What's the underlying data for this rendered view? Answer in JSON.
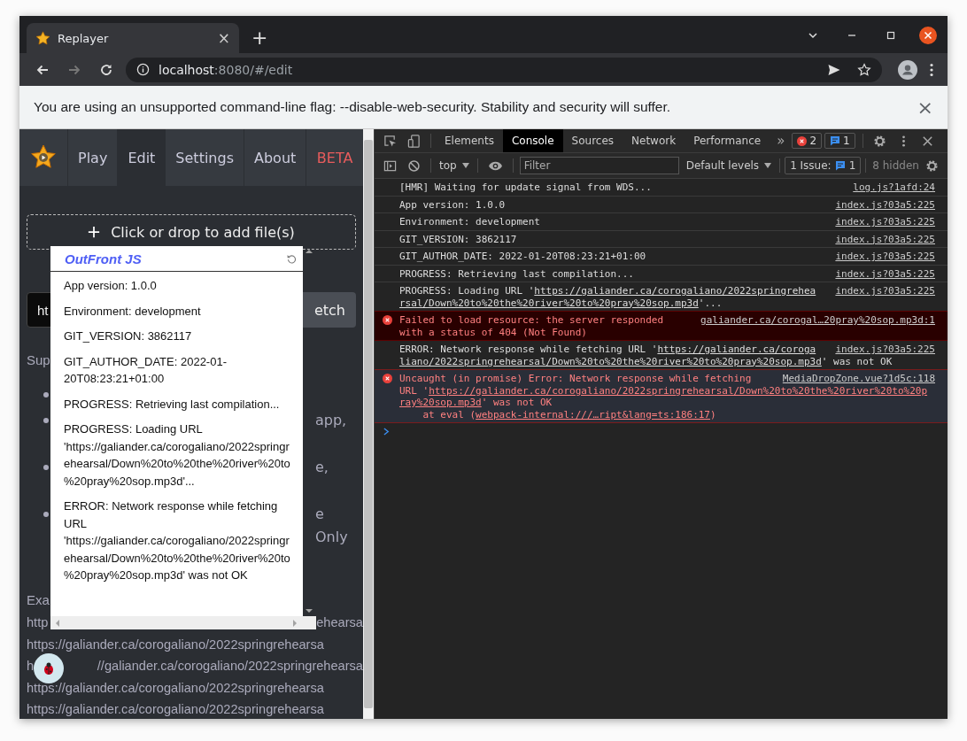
{
  "browser": {
    "tab": {
      "title": "Replayer",
      "close": "×"
    },
    "new_tab": "+",
    "forward_disabled": true,
    "address": {
      "host": "localhost",
      "path": ":8080/#/edit"
    }
  },
  "infobar": {
    "message": "You are using an unsupported command-line flag: --disable-web-security. Stability and security will suffer.",
    "close": "×"
  },
  "app": {
    "nav": [
      {
        "label": "Play",
        "selected": false,
        "kind": "normal"
      },
      {
        "label": "Edit",
        "selected": true,
        "kind": "normal"
      },
      {
        "label": "Settings",
        "selected": false,
        "kind": "normal"
      },
      {
        "label": "About",
        "selected": false,
        "kind": "normal"
      },
      {
        "label": "BETA",
        "selected": false,
        "kind": "beta"
      }
    ],
    "dropzone": "Click or drop to add file(s)",
    "url_field": {
      "value": "ht"
    },
    "fetch_button": "etch",
    "support_heading": "Sup",
    "bullets": [
      {
        "kind": "covered"
      },
      {
        "kind": "text",
        "lines": [
          "app,"
        ]
      },
      {
        "kind": "text",
        "lines": [
          "e,"
        ]
      },
      {
        "kind": "text",
        "lines": [
          "e",
          "Only"
        ]
      }
    ],
    "examples_heading": "Exa",
    "example_lines": [
      [
        "http",
        "ehearsa"
      ],
      [
        "https://galiander.ca/corogaliano/2022springrehearsa"
      ],
      [
        "h",
        "//galiander.ca/corogaliano/2022springrehearsa"
      ],
      [
        "https://galiander.ca/corogaliano/2022springrehearsa"
      ],
      [
        "https://galiander.ca/corogaliano/2022springrehearsa"
      ]
    ]
  },
  "log_popup": {
    "title": "OutFront JS",
    "entries": [
      "App version: 1.0.0",
      "Environment: development",
      "GIT_VERSION: 3862117",
      "GIT_AUTHOR_DATE: 2022-01-20T08:23:21+01:00",
      "PROGRESS: Retrieving last compilation...",
      "PROGRESS: Loading URL 'https://galiander.ca/corogaliano/2022springrehearsal/Down%20to%20the%20river%20to%20pray%20sop.mp3d'...",
      "ERROR: Network response while fetching URL 'https://galiander.ca/corogaliano/2022springrehearsal/Down%20to%20the%20river%20to%20pray%20sop.mp3d' was not OK"
    ]
  },
  "devtools": {
    "tabs": [
      {
        "label": "Elements",
        "selected": false
      },
      {
        "label": "Console",
        "selected": true
      },
      {
        "label": "Sources",
        "selected": false
      },
      {
        "label": "Network",
        "selected": false
      },
      {
        "label": "Performance",
        "selected": false
      }
    ],
    "more_tabs": "»",
    "error_count": "2",
    "message_count": "1",
    "context": "top",
    "filter": {
      "placeholder": "Filter"
    },
    "levels": "Default levels",
    "issues": "1 Issue:",
    "issues_count": "1",
    "hidden": "8 hidden",
    "messages": [
      {
        "kind": "log",
        "selected": false,
        "text": "[HMR] Waiting for update signal from WDS...",
        "source": "log.js?1afd:24"
      },
      {
        "kind": "log",
        "selected": false,
        "text": "App version: 1.0.0",
        "source": "index.js?03a5:225"
      },
      {
        "kind": "log",
        "selected": false,
        "text": "Environment: development",
        "source": "index.js?03a5:225"
      },
      {
        "kind": "log",
        "selected": false,
        "text": "GIT_VERSION: 3862117",
        "source": "index.js?03a5:225"
      },
      {
        "kind": "log",
        "selected": false,
        "text": "GIT_AUTHOR_DATE: 2022-01-20T08:23:21+01:00",
        "source": "index.js?03a5:225"
      },
      {
        "kind": "log",
        "selected": false,
        "text": "PROGRESS: Retrieving last compilation...",
        "source": "index.js?03a5:225"
      },
      {
        "kind": "log",
        "selected": false,
        "source": "index.js?03a5:225",
        "lines": [
          [
            {
              "text": "PROGRESS: Loading URL '",
              "link": false
            },
            {
              "text": "https://galiander.ca/corogaliano/2022springrehea",
              "link": true
            }
          ],
          [
            {
              "text": "rsal/Down%20to%20the%20river%20to%20pray%20sop.mp3d",
              "link": true
            },
            {
              "text": "'...",
              "link": false
            }
          ]
        ]
      },
      {
        "kind": "error",
        "selected": false,
        "source": "galiander.ca/corogal…20pray%20sop.mp3d:1",
        "lines": [
          [
            {
              "text": "Failed to load resource: the server responded",
              "link": false
            }
          ],
          [
            {
              "text": "with a status of 404 (Not Found)",
              "link": false
            }
          ]
        ]
      },
      {
        "kind": "log",
        "selected": false,
        "source": "index.js?03a5:225",
        "lines": [
          [
            {
              "text": "ERROR: Network response while fetching URL '",
              "link": false
            },
            {
              "text": "https://galiander.ca/coroga",
              "link": true
            }
          ],
          [
            {
              "text": "liano/2022springrehearsal/Down%20to%20the%20river%20to%20pray%20sop.mp3d",
              "link": true
            },
            {
              "text": "' was not OK",
              "link": false
            }
          ]
        ]
      },
      {
        "kind": "error",
        "selected": true,
        "source": "MediaDropZone.vue?1d5c:118",
        "lines": [
          [
            {
              "text": "Uncaught (in promise) Error: Network response while fetching",
              "link": false
            }
          ],
          [
            {
              "text": "URL '",
              "link": false
            },
            {
              "text": "https://galiander.ca/corogaliano/2022springrehearsal/Down%20to%20the%20river%20to%20p",
              "link": true
            }
          ],
          [
            {
              "text": "ray%20sop.mp3d",
              "link": true
            },
            {
              "text": "' was not OK",
              "link": false
            }
          ],
          [
            {
              "text": "    at eval (",
              "link": false
            },
            {
              "text": "webpack-internal:///…ript&lang=ts:186:17",
              "link": true
            },
            {
              "text": ")",
              "link": false
            }
          ]
        ]
      }
    ]
  }
}
